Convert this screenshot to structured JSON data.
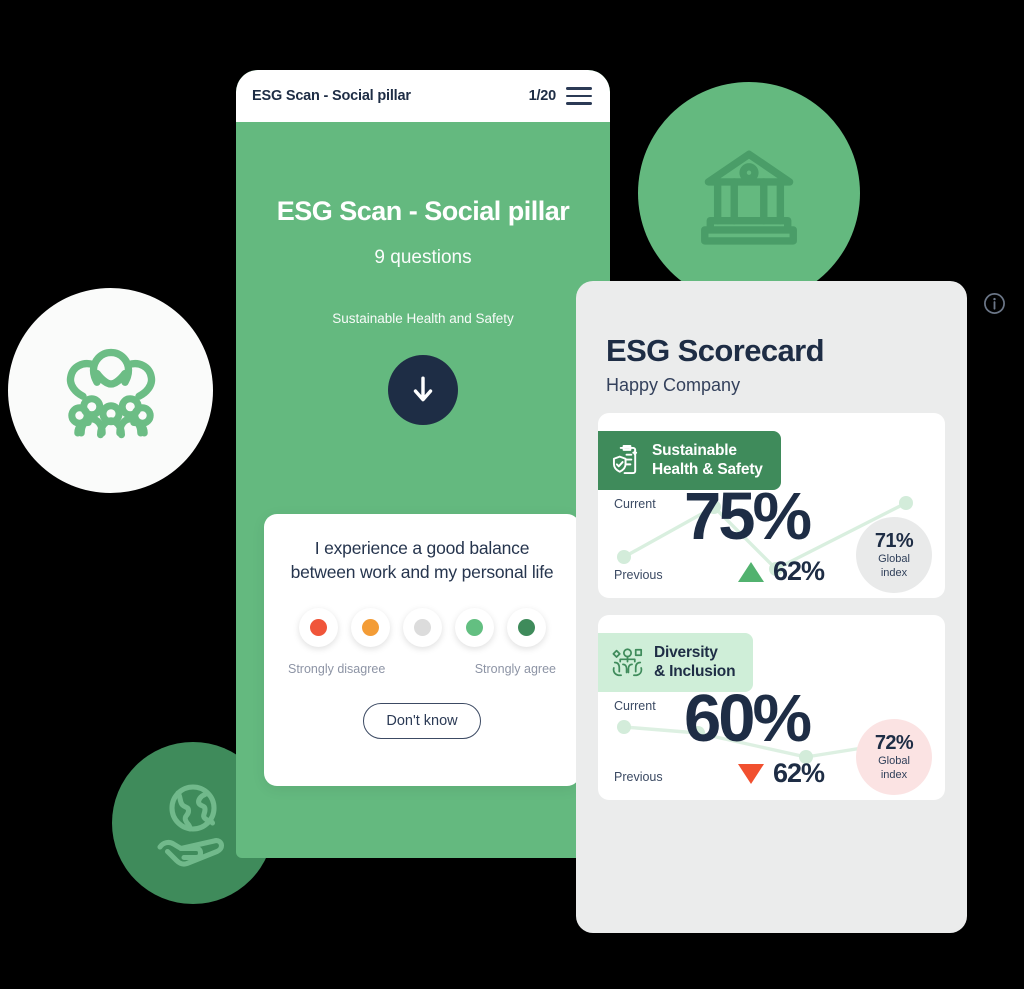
{
  "phone": {
    "topbar": {
      "title": "ESG Scan - Social pillar",
      "progress": "1/20",
      "menu_icon": "hamburger-icon"
    },
    "hero": {
      "title": "ESG Scan - Social pillar",
      "questions": "9 questions",
      "pillar": "Sustainable Health and Safety",
      "scroll_icon": "arrow-down-icon"
    },
    "question": {
      "text": "I experience a good balance between work and my personal life",
      "options": [
        {
          "name": "strongly-disagree",
          "color": "#f0553a"
        },
        {
          "name": "disagree",
          "color": "#f39c36"
        },
        {
          "name": "neutral",
          "color": "#dcdcdc"
        },
        {
          "name": "agree",
          "color": "#63bf81"
        },
        {
          "name": "strongly-agree",
          "color": "#3f8b5b"
        }
      ],
      "label_left": "Strongly disagree",
      "label_right": "Strongly agree",
      "dont_know": "Don't know"
    }
  },
  "scorecard": {
    "info_icon": "info-icon",
    "title": "ESG Scorecard",
    "company": "Happy Company",
    "labels": {
      "current": "Current",
      "previous": "Previous",
      "global_line1": "Global",
      "global_line2": "index"
    },
    "cards": [
      {
        "icon": "clipboard-health-icon",
        "badge_line1": "Sustainable",
        "badge_line2": "Health & Safety",
        "badge_style": "green",
        "current": "75%",
        "previous": "62%",
        "trend": "up",
        "global_index": "71%",
        "global_style": "grey"
      },
      {
        "icon": "diversity-people-icon",
        "badge_line1": "Diversity",
        "badge_line2": "& Inclusion",
        "badge_style": "pale",
        "current": "60%",
        "previous": "62%",
        "trend": "down",
        "global_index": "72%",
        "global_style": "pink"
      }
    ]
  },
  "decorations": [
    {
      "name": "social-people-icon",
      "circle_color": "#fafbfa",
      "icon_color": "#6cbd85"
    },
    {
      "name": "governance-bank-icon",
      "circle_color": "#64b97f",
      "icon_color": "#4a9d68"
    },
    {
      "name": "environment-earth-hand-icon",
      "circle_color": "#3f8b5b",
      "icon_color": "#71b98b"
    }
  ],
  "chart_data": [
    {
      "type": "line",
      "title": "Sustainable Health & Safety trend",
      "x": [
        0,
        1,
        2,
        3
      ],
      "values": [
        40,
        80,
        25,
        85
      ],
      "ylim": [
        0,
        100
      ],
      "series": [
        {
          "name": "score",
          "values": [
            40,
            80,
            25,
            85
          ]
        }
      ],
      "grid": false,
      "legend": "none"
    },
    {
      "type": "line",
      "title": "Diversity & Inclusion trend",
      "x": [
        0,
        1,
        2,
        3
      ],
      "values": [
        62,
        58,
        40,
        48
      ],
      "ylim": [
        0,
        100
      ],
      "series": [
        {
          "name": "score",
          "values": [
            62,
            58,
            40,
            48
          ]
        }
      ],
      "grid": false,
      "legend": "none"
    }
  ]
}
